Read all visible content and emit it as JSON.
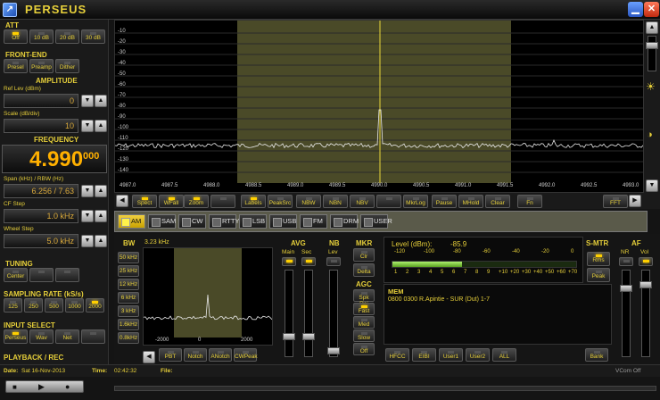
{
  "app": {
    "title": "PERSEUS",
    "icon": "app-logo-icon",
    "minimize": "minimize-icon",
    "close": "close-icon"
  },
  "att": {
    "label": "ATT",
    "buttons": [
      {
        "label": "Off",
        "on": true
      },
      {
        "label": "10 dB",
        "on": false
      },
      {
        "label": "20 dB",
        "on": false
      },
      {
        "label": "30 dB",
        "on": false
      }
    ]
  },
  "front_end": {
    "label": "FRONT-END",
    "buttons": [
      {
        "label": "Presel",
        "on": false
      },
      {
        "label": "Preamp",
        "on": false
      },
      {
        "label": "Dither",
        "on": false
      }
    ]
  },
  "amplitude": {
    "label": "AMPLITUDE",
    "ref_label": "Ref Lev (dBm)",
    "ref_value": "0",
    "scale_label": "Scale (dB/div)",
    "scale_value": "10"
  },
  "frequency": {
    "label": "FREQUENCY",
    "main": "4.990",
    "sub": "000",
    "span_label": "Span (kHz) / RBW (Hz)",
    "span_value": "6.256 / 7.63",
    "cf_label": "CF Step",
    "cf_value": "1.0 kHz",
    "wheel_label": "Wheel Step",
    "wheel_value": "5.0 kHz"
  },
  "tuning": {
    "label": "TUNING",
    "buttons": [
      "Center",
      "",
      ""
    ]
  },
  "sampling": {
    "label": "SAMPLING RATE (kS/s)",
    "buttons": [
      {
        "label": "125",
        "on": false
      },
      {
        "label": "250",
        "on": false
      },
      {
        "label": "500",
        "on": false
      },
      {
        "label": "1000",
        "on": false
      },
      {
        "label": "2000",
        "on": true
      }
    ]
  },
  "input": {
    "label": "INPUT SELECT",
    "buttons": [
      {
        "label": "Perseus",
        "on": true
      },
      {
        "label": "Wav",
        "on": false
      },
      {
        "label": "Net",
        "on": false
      },
      {
        "label": "",
        "on": false
      }
    ]
  },
  "playback": {
    "label": "PLAYBACK / REC",
    "date_label": "Date:",
    "date": "Sat 16-Nov-2013",
    "time_label": "Time:",
    "time": "02:42:32",
    "file_label": "File:",
    "vcom": "VCom Off"
  },
  "spectrum": {
    "y_ticks": [
      "-10",
      "-20",
      "-30",
      "-40",
      "-50",
      "-60",
      "-70",
      "-80",
      "-90",
      "-100",
      "-110",
      "-120",
      "-130",
      "-140"
    ],
    "x_ticks": [
      "4987.0",
      "4987.5",
      "4988.0",
      "4988.5",
      "4989.0",
      "4989.5",
      "4990.0",
      "4990.5",
      "4991.0",
      "4991.5",
      "4992.0",
      "4992.5",
      "4993.0"
    ]
  },
  "spec_buttons": [
    {
      "label": "Spect",
      "on": true
    },
    {
      "label": "WFall",
      "on": true
    },
    {
      "label": "Zoom",
      "on": true
    },
    {
      "label": "",
      "on": false
    },
    {
      "label": "Labels",
      "on": true
    },
    {
      "label": "PeakSrc",
      "on": false
    },
    {
      "label": "NBW",
      "on": false
    },
    {
      "label": "NBN",
      "on": false
    },
    {
      "label": "NBV",
      "on": false
    },
    {
      "label": "",
      "on": false
    },
    {
      "label": "MkrLog",
      "on": false
    },
    {
      "label": "Pause",
      "on": false
    },
    {
      "label": "MHold",
      "on": false
    },
    {
      "label": "Clear",
      "on": false
    },
    {
      "label": "Fn",
      "on": false
    },
    {
      "label": "FFT",
      "on": false
    }
  ],
  "modes": [
    {
      "label": "AM",
      "on": true
    },
    {
      "label": "SAM",
      "on": false
    },
    {
      "label": "CW",
      "on": false
    },
    {
      "label": "RTTY",
      "on": false
    },
    {
      "label": "LSB",
      "on": false
    },
    {
      "label": "USB",
      "on": false
    },
    {
      "label": "FM",
      "on": false
    },
    {
      "label": "DRM",
      "on": false
    },
    {
      "label": "USER",
      "on": false
    }
  ],
  "bw": {
    "label": "BW",
    "value": "3.23 kHz",
    "buttons": [
      "50 kHz",
      "25 kHz",
      "12 kHz",
      "6 kHz",
      "3 kHz",
      "1.6kHz",
      "0.8kHz"
    ],
    "x_ticks": [
      "-2000",
      "0",
      "2000"
    ]
  },
  "filter_buttons": [
    {
      "label": "PBT",
      "on": false
    },
    {
      "label": "Notch",
      "on": false
    },
    {
      "label": "ANotch",
      "on": false
    },
    {
      "label": "CWPeak",
      "on": false
    }
  ],
  "avg": {
    "label": "AVG",
    "main": "Main",
    "sec": "Sec"
  },
  "nb": {
    "label": "NB",
    "lev": "Lev"
  },
  "mkr": {
    "label": "MKR",
    "buttons": [
      "Clr",
      "Delta"
    ]
  },
  "agc": {
    "label": "AGC",
    "buttons": [
      {
        "label": "Spk Rej",
        "on": false
      },
      {
        "label": "Fast",
        "on": true
      },
      {
        "label": "Med",
        "on": false
      },
      {
        "label": "Slow",
        "on": false
      },
      {
        "label": "Off",
        "on": false
      }
    ]
  },
  "smeter": {
    "level_label": "Level (dBm):",
    "level": "-85.9",
    "scale_top": [
      "-120",
      "-100",
      "-80",
      "-60",
      "-40",
      "-20",
      "0"
    ],
    "scale_bot": [
      "1",
      "2",
      "3",
      "4",
      "5",
      "6",
      "7",
      "8",
      "9",
      "+10",
      "+20",
      "+30",
      "+40",
      "+50",
      "+60",
      "+70"
    ],
    "fill_fraction": 0.38
  },
  "smtr": {
    "label": "S-MTR",
    "buttons": [
      "Rms",
      "Peak"
    ]
  },
  "af": {
    "label": "AF",
    "nr": "NR",
    "vol": "Vol"
  },
  "mem": {
    "label": "MEM",
    "entry": "0800 0300 R.Apintie  - SUR (Dut)   1-7",
    "buttons": [
      "HFCC",
      "EIBI",
      "User1",
      "User2",
      "ALL"
    ],
    "bank": "Bank"
  },
  "colors": {
    "accent": "#e6cf3a",
    "led_on": "#ffd000",
    "trace": "#e8e8e8",
    "passband": "#4a4a28",
    "marker": "#e6d43a"
  }
}
